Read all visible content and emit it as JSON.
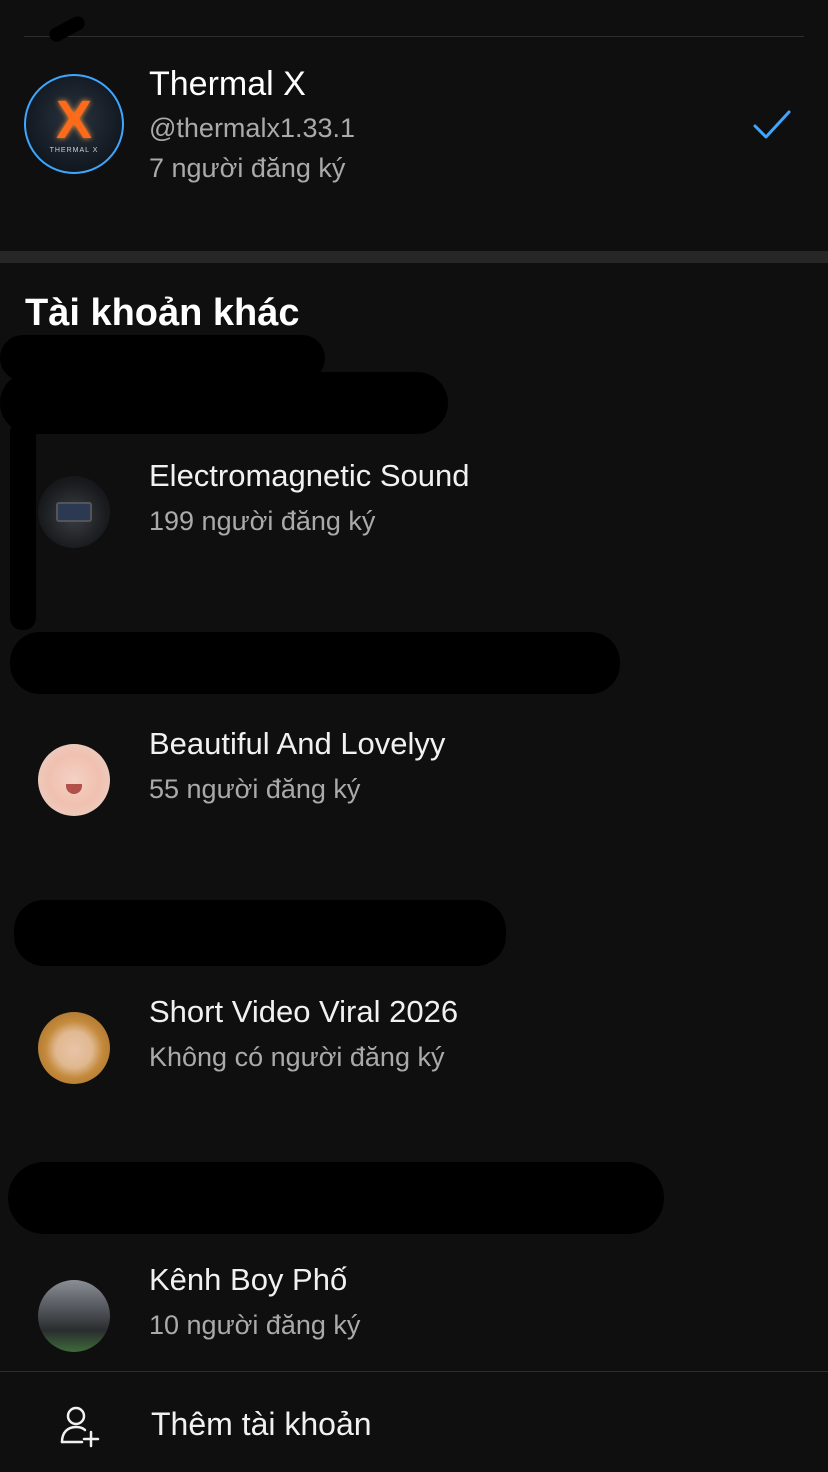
{
  "current_account": {
    "name": "Thermal X",
    "handle": "@thermalx1.33.1",
    "subscribers": "7 người đăng ký",
    "avatar_letter": "X",
    "avatar_caption": "THERMAL X",
    "check_icon": "check-icon"
  },
  "other_accounts": {
    "title": "Tài khoản khác",
    "items": [
      {
        "name": "Electromagnetic Sound",
        "subscribers": "199 người đăng ký"
      },
      {
        "name": "Beautiful And Lovelyy",
        "subscribers": "55 người đăng ký"
      },
      {
        "name": "Short Video Viral 2026",
        "subscribers": "Không có người đăng ký"
      },
      {
        "name": "Kênh Boy Phố",
        "subscribers": "10 người đăng ký"
      }
    ]
  },
  "footer": {
    "add_account_label": "Thêm tài khoản",
    "add_account_icon": "add-person-icon"
  },
  "colors": {
    "background": "#0f0f0f",
    "accent": "#3ea6ff",
    "secondary_text": "#aaaaaa"
  }
}
